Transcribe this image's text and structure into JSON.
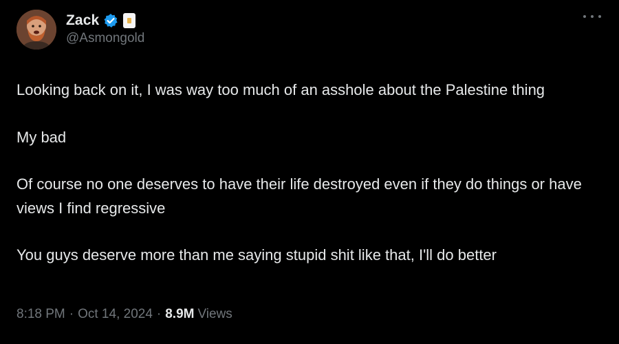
{
  "author": {
    "display_name": "Zack",
    "handle": "@Asmongold",
    "verified_color": "#1d9bf0",
    "avatar_icon": "avatar-bearded-man"
  },
  "menu_icon": "more-horizontal-icon",
  "tweet": {
    "paragraphs": [
      "Looking back on it, I was way too much of an asshole about the Palestine thing",
      "My bad",
      "Of course no one deserves to have their life destroyed even if they do things or have views I find regressive",
      "You guys deserve more than me saying stupid shit like that, I'll do better"
    ]
  },
  "meta": {
    "time": "8:18 PM",
    "separator": "·",
    "date": "Oct 14, 2024",
    "views_count": "8.9M",
    "views_label": "Views"
  },
  "colors": {
    "background": "#000000",
    "text": "#e7e9ea",
    "muted": "#71767b"
  }
}
